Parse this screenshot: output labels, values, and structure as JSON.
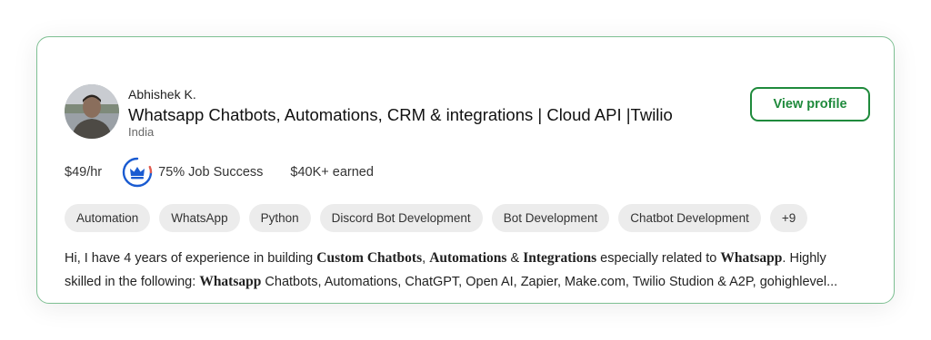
{
  "profile": {
    "name": "Abhishek K.",
    "headline": "Whatsapp Chatbots, Automations, CRM & integrations | Cloud API |Twilio",
    "location": "India",
    "view_profile_label": "View profile",
    "avatar_icon": "person-photo-avatar"
  },
  "stats": {
    "rate": "$49/hr",
    "job_success": "75% Job Success",
    "job_success_icon": "crown-badge-icon",
    "earned": "$40K+ earned"
  },
  "skills": [
    "Automation",
    "WhatsApp",
    "Python",
    "Discord Bot Development",
    "Bot Development",
    "Chatbot Development",
    "+9"
  ],
  "description": {
    "line1": [
      {
        "t": "Hi, I have 4 years of experience in building ",
        "b": false
      },
      {
        "t": "Custom Chatbots",
        "b": true
      },
      {
        "t": ", ",
        "b": false
      },
      {
        "t": "Automations",
        "b": true
      },
      {
        "t": " & ",
        "b": false
      },
      {
        "t": "Integrations",
        "b": true
      },
      {
        "t": " especially related to ",
        "b": false
      },
      {
        "t": "Whatsapp",
        "b": true
      },
      {
        "t": ". Highly",
        "b": false
      }
    ],
    "line2": [
      {
        "t": "skilled in the following: ",
        "b": false
      },
      {
        "t": "Whatsapp",
        "b": true
      },
      {
        "t": " Chatbots, Automations, ChatGPT, Open AI, Zapier, Make.com, Twilio Studion & A2P, gohighlevel...",
        "b": false
      }
    ]
  },
  "colors": {
    "accent": "#1f8a3c",
    "card_border": "#7dbf92",
    "badge_blue": "#1a5bd1",
    "chip_bg": "#ececec"
  }
}
